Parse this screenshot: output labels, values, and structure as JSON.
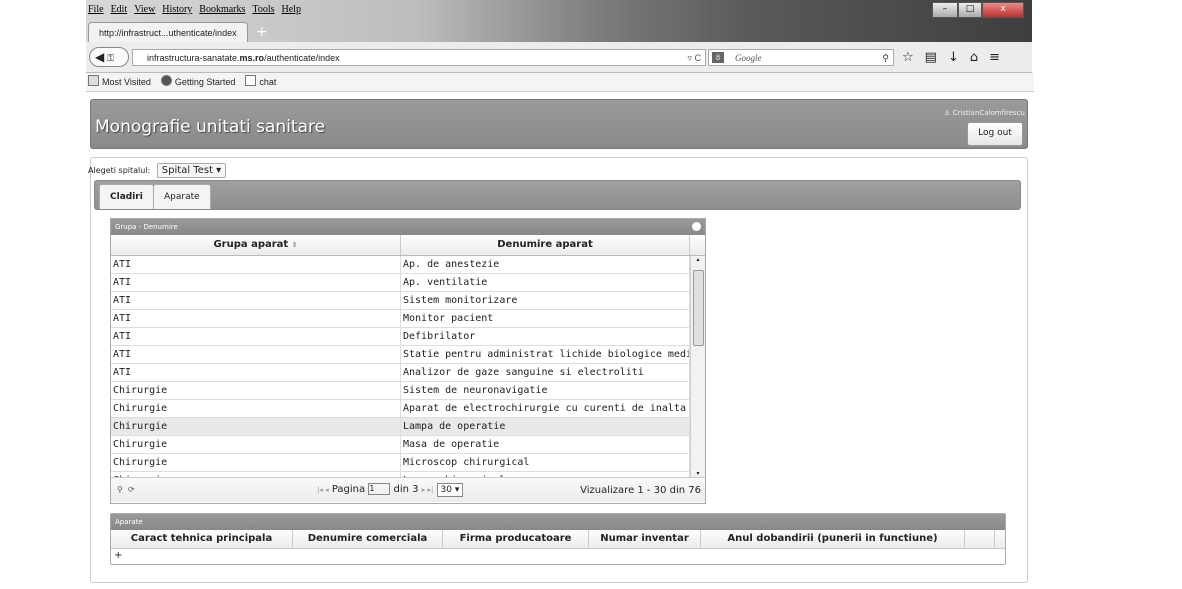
{
  "browser": {
    "menu": [
      "File",
      "Edit",
      "View",
      "History",
      "Bookmarks",
      "Tools",
      "Help"
    ],
    "tab_title": "http://infrastruct...uthenticate/index",
    "url_prefix": "infrastructura-sanatate.",
    "url_domain": "ms.ro",
    "url_path": "/authenticate/index",
    "search_placeholder": "Google",
    "bookmarks": [
      "Most Visited",
      "Getting Started",
      "chat"
    ]
  },
  "header": {
    "title": "Monografie unitati sanitare",
    "user": "CristianCalomfirescu",
    "logout_label": "Log out"
  },
  "hospital": {
    "label": "Alegeti spitalul:",
    "selected": "Spital Test"
  },
  "tabs": [
    {
      "label": "Cladiri"
    },
    {
      "label": "Aparate"
    }
  ],
  "grid": {
    "caption": "Grupa - Denumire",
    "columns": [
      "Grupa aparat",
      "Denumire aparat"
    ],
    "rows": [
      [
        "ATI",
        "Ap. de anestezie"
      ],
      [
        "ATI",
        "Ap. ventilatie"
      ],
      [
        "ATI",
        "Sistem monitorizare"
      ],
      [
        "ATI",
        "Monitor pacient"
      ],
      [
        "ATI",
        "Defibrilator"
      ],
      [
        "ATI",
        "Statie pentru administrat lichide biologice medicamentoase"
      ],
      [
        "ATI",
        "Analizor de gaze sanguine si electroliti"
      ],
      [
        "Chirurgie",
        "Sistem de neuronavigatie"
      ],
      [
        "Chirurgie",
        "Aparat  de electrochirurgie cu curenti de inalta frecventa"
      ],
      [
        "Chirurgie",
        "Lampa de operatie"
      ],
      [
        "Chirurgie",
        "Masa de operatie"
      ],
      [
        "Chirurgie",
        "Microscop chirurgical"
      ],
      [
        "Chirurgie",
        "Laser chirurgical"
      ]
    ],
    "selected_row": 9,
    "pager": {
      "page_label": "Pagina",
      "page_value": "1",
      "of_label": "din 3",
      "rows_per_page": "30",
      "count": "Vizualizare 1 - 30 din 76"
    }
  },
  "grid2": {
    "caption": "Aparate",
    "columns": [
      "Caract tehnica principala",
      "Denumire comerciala",
      "Firma producatoare",
      "Numar inventar",
      "Anul dobandirii (punerii in functiune)"
    ],
    "add_label": "+"
  }
}
